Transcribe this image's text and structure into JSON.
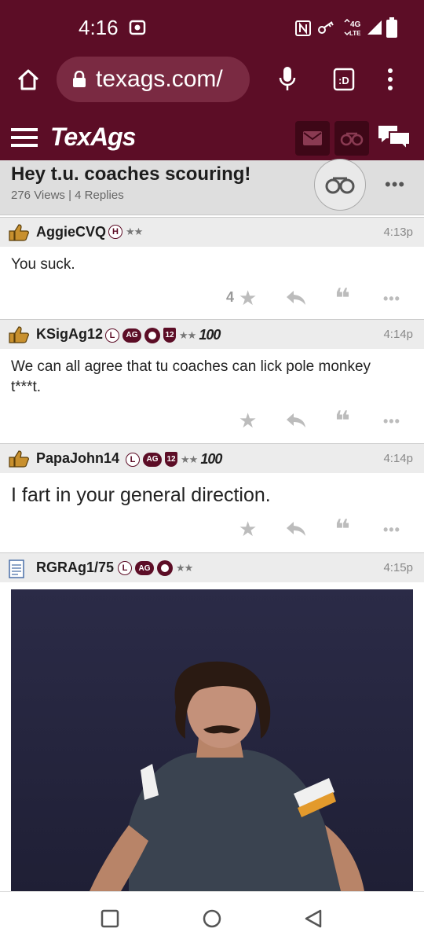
{
  "status": {
    "time": "4:16",
    "network": "4G LTE"
  },
  "browser": {
    "url": "texags.com/"
  },
  "site": {
    "logo": "TexAgs"
  },
  "topic": {
    "title": "Hey t.u. coaches scouring!",
    "meta": "276 Views | 4 Replies",
    "more": "•••"
  },
  "posts": [
    {
      "user": "AggieCVQ",
      "badge_h": "H",
      "time": "4:13p",
      "body": "You suck.",
      "star_count": "4"
    },
    {
      "user": "KSigAg12",
      "badge_l": "L",
      "badge_ag": "AG",
      "badge_12": "12",
      "badge_100": "100",
      "time": "4:14p",
      "body": "We can all agree that tu coaches can lick pole monkey t***t."
    },
    {
      "user": "PapaJohn14",
      "badge_l": "L",
      "badge_ag": "AG",
      "badge_12": "12",
      "badge_100": "100",
      "time": "4:14p",
      "body": "I fart in your general direction."
    },
    {
      "user": "RGRAg1/75",
      "badge_l": "L",
      "badge_ag": "AG",
      "time": "4:15p"
    }
  ],
  "colors": {
    "brand": "#5c0d26",
    "header_gray": "#dedede"
  }
}
